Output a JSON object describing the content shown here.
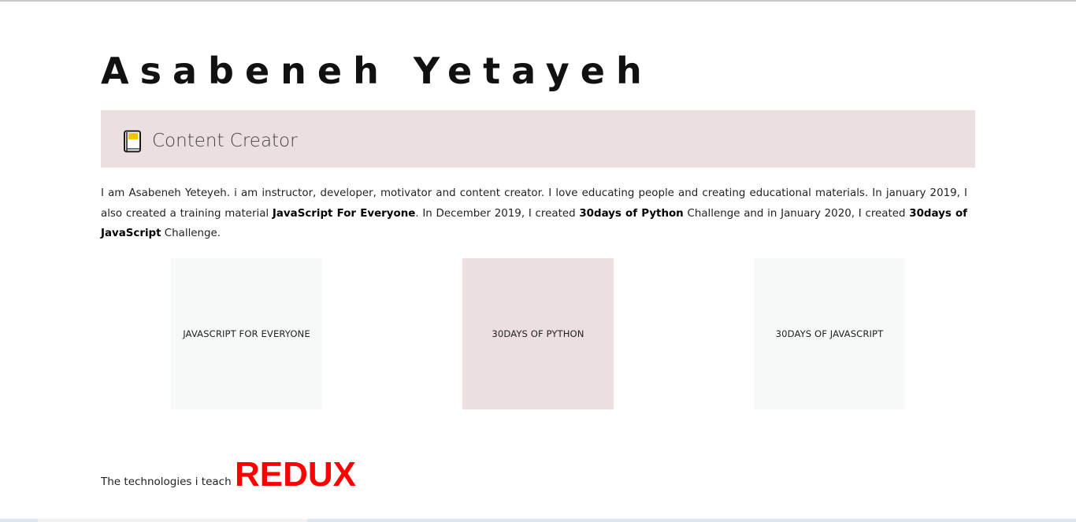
{
  "header": {
    "name": "Asabeneh Yetayeh"
  },
  "role": {
    "icon": "book-icon",
    "label": "Content Creator",
    "background": "#ecdfdf"
  },
  "bio": {
    "part1": "I am Asabeneh Yeteyeh. i am instructor, developer, motivator and content creator. I love educating people and creating educational materials. In january 2019, I also created a training material ",
    "strong1": "JavaScript For Everyone",
    "part2": ". In December 2019, I created ",
    "strong2": "30days of Python",
    "part3": " Challenge and in January 2020, I created ",
    "strong3": "30days of JavaScript",
    "part4": " Challenge."
  },
  "cards": [
    {
      "label": "JAVASCRIPT FOR EVERYONE",
      "color": "#f7f8f8"
    },
    {
      "label": "30DAYS OF PYTHON",
      "color": "#ecdfdf"
    },
    {
      "label": "30DAYS OF JAVASCRIPT",
      "color": "#f7f8f8"
    }
  ],
  "technologies": {
    "label": "The technologies i teach",
    "current": "REDUX",
    "current_color": "#ff0000"
  }
}
